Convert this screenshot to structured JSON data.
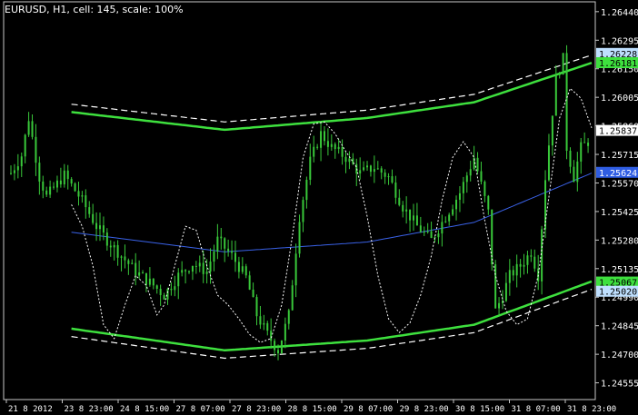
{
  "chart_title": "EURUSD, H1, cell: 145, scale: 100%",
  "colors": {
    "background": "#000000",
    "frame": "#c8c8c8",
    "grid": "#2a2a2a",
    "candles": "#39c83a",
    "outer_channel": "#3ee03e",
    "dashed_channel": "#ffffff",
    "center_line": "#3a62e8",
    "price_line": "#ffffff",
    "tag_green": "#3ee03e",
    "tag_blue": "#2f5de3",
    "tag_lightblue": "#bfe0ff",
    "tag_white": "#ffffff"
  },
  "chart_data": {
    "type": "candlestick",
    "y_axis_ticks": [
      "1.26440",
      "1.26295",
      "1.26150",
      "1.26005",
      "1.25860",
      "1.25715",
      "1.25570",
      "1.25425",
      "1.25280",
      "1.25135",
      "1.24990",
      "1.24845",
      "1.24700",
      "1.24555"
    ],
    "ylim": [
      1.2447,
      1.2649
    ],
    "x_axis_ticks": [
      "21 8 2012",
      "23 8 23:00",
      "24 8 15:00",
      "27 8 07:00",
      "27 8 23:00",
      "28 8 15:00",
      "29 8 07:00",
      "29 8 23:00",
      "30 8 15:00",
      "31 8 07:00",
      "31 8 23:00"
    ],
    "price_tags": [
      {
        "label": "1.26228",
        "value": 1.26228,
        "style": "lightblue"
      },
      {
        "label": "1.26181",
        "value": 1.26181,
        "style": "green"
      },
      {
        "label": "1.25837",
        "value": 1.25837,
        "style": "white"
      },
      {
        "label": "1.25624",
        "value": 1.25624,
        "style": "blue"
      },
      {
        "label": "1.25067",
        "value": 1.25067,
        "style": "green"
      },
      {
        "label": "1.25020",
        "value": 1.2502,
        "style": "lightblue"
      }
    ],
    "close_anchors": [
      [
        0,
        1.2562
      ],
      [
        3,
        1.2571
      ],
      [
        5,
        1.259
      ],
      [
        8,
        1.256
      ],
      [
        10,
        1.255
      ],
      [
        15,
        1.2561
      ],
      [
        20,
        1.2548
      ],
      [
        24,
        1.2535
      ],
      [
        27,
        1.2528
      ],
      [
        31,
        1.252
      ],
      [
        35,
        1.2512
      ],
      [
        40,
        1.2505
      ],
      [
        43,
        1.25
      ],
      [
        47,
        1.251
      ],
      [
        51,
        1.2516
      ],
      [
        55,
        1.2512
      ],
      [
        58,
        1.2528
      ],
      [
        62,
        1.252
      ],
      [
        66,
        1.2509
      ],
      [
        69,
        1.249
      ],
      [
        72,
        1.248
      ],
      [
        75,
        1.2472
      ],
      [
        78,
        1.249
      ],
      [
        81,
        1.254
      ],
      [
        84,
        1.2568
      ],
      [
        87,
        1.2582
      ],
      [
        90,
        1.2575
      ],
      [
        94,
        1.257
      ],
      [
        98,
        1.2562
      ],
      [
        102,
        1.2565
      ],
      [
        106,
        1.256
      ],
      [
        110,
        1.2545
      ],
      [
        114,
        1.2535
      ],
      [
        118,
        1.2528
      ],
      [
        122,
        1.254
      ],
      [
        126,
        1.2552
      ],
      [
        130,
        1.257
      ],
      [
        134,
        1.2542
      ],
      [
        136,
        1.2492
      ],
      [
        138,
        1.25
      ],
      [
        140,
        1.251
      ],
      [
        143,
        1.2515
      ],
      [
        146,
        1.2522
      ],
      [
        148,
        1.251
      ],
      [
        150,
        1.256
      ],
      [
        153,
        1.261
      ],
      [
        155,
        1.262
      ],
      [
        156,
        1.2575
      ],
      [
        158,
        1.256
      ],
      [
        160,
        1.2575
      ],
      [
        162,
        1.2578
      ]
    ],
    "price_line_anchors": [
      [
        17,
        1.2546
      ],
      [
        20,
        1.2535
      ],
      [
        23,
        1.2515
      ],
      [
        26,
        1.2485
      ],
      [
        29,
        1.2478
      ],
      [
        32,
        1.2495
      ],
      [
        35,
        1.251
      ],
      [
        38,
        1.2505
      ],
      [
        41,
        1.249
      ],
      [
        43,
        1.2495
      ],
      [
        46,
        1.2515
      ],
      [
        49,
        1.2535
      ],
      [
        52,
        1.2533
      ],
      [
        55,
        1.2515
      ],
      [
        58,
        1.25
      ],
      [
        61,
        1.2495
      ],
      [
        64,
        1.2488
      ],
      [
        67,
        1.248
      ],
      [
        70,
        1.2476
      ],
      [
        73,
        1.2478
      ],
      [
        76,
        1.2495
      ],
      [
        79,
        1.253
      ],
      [
        82,
        1.257
      ],
      [
        85,
        1.2587
      ],
      [
        88,
        1.2588
      ],
      [
        91,
        1.2582
      ],
      [
        94,
        1.2573
      ],
      [
        97,
        1.2565
      ],
      [
        100,
        1.254
      ],
      [
        103,
        1.251
      ],
      [
        106,
        1.2488
      ],
      [
        109,
        1.2481
      ],
      [
        112,
        1.2486
      ],
      [
        115,
        1.25
      ],
      [
        118,
        1.252
      ],
      [
        121,
        1.2548
      ],
      [
        124,
        1.257
      ],
      [
        127,
        1.2578
      ],
      [
        130,
        1.257
      ],
      [
        133,
        1.2538
      ],
      [
        136,
        1.251
      ],
      [
        139,
        1.2492
      ],
      [
        142,
        1.2485
      ],
      [
        145,
        1.2488
      ],
      [
        148,
        1.251
      ],
      [
        151,
        1.255
      ],
      [
        154,
        1.259
      ],
      [
        157,
        1.2605
      ],
      [
        160,
        1.26
      ],
      [
        163,
        1.2585
      ]
    ],
    "center_curve": [
      [
        17,
        1.2532
      ],
      [
        60,
        1.2522
      ],
      [
        100,
        1.2527
      ],
      [
        130,
        1.2537
      ],
      [
        163,
        1.2562
      ]
    ],
    "outer_upper_curve": [
      [
        17,
        1.2593
      ],
      [
        60,
        1.2584
      ],
      [
        100,
        1.259
      ],
      [
        130,
        1.2598
      ],
      [
        163,
        1.2618
      ]
    ],
    "outer_lower_curve": [
      [
        17,
        1.2483
      ],
      [
        60,
        1.2472
      ],
      [
        100,
        1.2477
      ],
      [
        130,
        1.2485
      ],
      [
        163,
        1.2507
      ]
    ],
    "dashed_upper_curve": [
      [
        17,
        1.2597
      ],
      [
        60,
        1.2588
      ],
      [
        100,
        1.2594
      ],
      [
        130,
        1.2602
      ],
      [
        163,
        1.2622
      ]
    ],
    "dashed_lower_curve": [
      [
        17,
        1.2479
      ],
      [
        60,
        1.2468
      ],
      [
        100,
        1.2473
      ],
      [
        130,
        1.2481
      ],
      [
        163,
        1.2503
      ]
    ]
  }
}
